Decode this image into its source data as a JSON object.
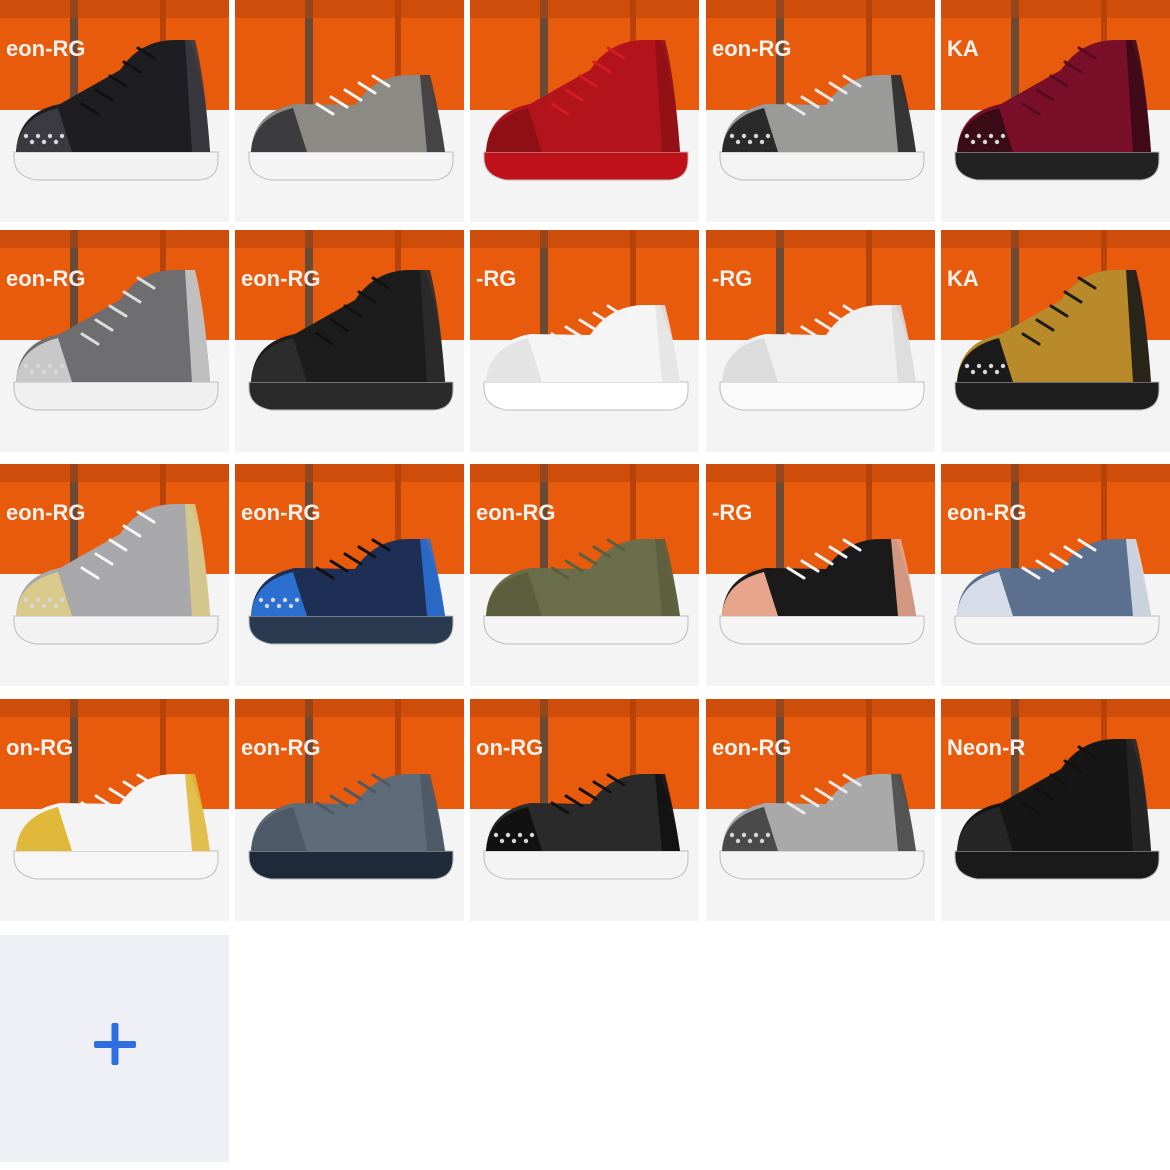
{
  "gallery": {
    "photos": [
      {
        "label": "eon-RG",
        "shoe": {
          "upper": "#1e1e22",
          "accent": "#3a3a40",
          "sole": "#f2f2f2",
          "laces": "#111111",
          "spikes": true,
          "high": true
        }
      },
      {
        "label": "",
        "shoe": {
          "upper": "#8c8a84",
          "accent": "#3c3c3e",
          "sole": "#f4f4f4",
          "laces": "#f4f4f4",
          "spikes": false,
          "high": false
        }
      },
      {
        "label": "",
        "shoe": {
          "upper": "#b3141c",
          "accent": "#8f0f16",
          "sole": "#c0121a",
          "laces": "#d21d25",
          "spikes": false,
          "high": true
        }
      },
      {
        "label": "eon-RG",
        "shoe": {
          "upper": "#9a9a98",
          "accent": "#2a2a2a",
          "sole": "#f3f3f3",
          "laces": "#e9e9e9",
          "spikes": true,
          "high": false
        }
      },
      {
        "label": "KA",
        "shoe": {
          "upper": "#7a0f2a",
          "accent": "#3a0a16",
          "sole": "#222222",
          "laces": "#5a0a1e",
          "spikes": true,
          "high": true
        }
      },
      {
        "label": "eon-RG",
        "shoe": {
          "upper": "#6e6e70",
          "accent": "#c8c8c8",
          "sole": "#f0f0f0",
          "laces": "#dddddd",
          "spikes": true,
          "high": true
        }
      },
      {
        "label": "eon-RG",
        "shoe": {
          "upper": "#1c1c1c",
          "accent": "#2c2c2c",
          "sole": "#2a2a2a",
          "laces": "#111111",
          "spikes": false,
          "high": true
        }
      },
      {
        "label": "-RG",
        "shoe": {
          "upper": "#f5f5f5",
          "accent": "#e4e4e4",
          "sole": "#ffffff",
          "laces": "#f0f0f0",
          "spikes": false,
          "high": false
        }
      },
      {
        "label": "-RG",
        "shoe": {
          "upper": "#efefef",
          "accent": "#dcdcdc",
          "sole": "#fafafa",
          "laces": "#eeeeee",
          "spikes": false,
          "high": false
        }
      },
      {
        "label": "KA",
        "shoe": {
          "upper": "#b88a2a",
          "accent": "#1a1a1a",
          "sole": "#1e1e1e",
          "laces": "#1a1a1a",
          "spikes": true,
          "high": true
        }
      },
      {
        "label": "eon-RG",
        "shoe": {
          "upper": "#a8a8aa",
          "accent": "#d9c98a",
          "sole": "#f2f2f2",
          "laces": "#f5f5f5",
          "spikes": true,
          "high": true
        }
      },
      {
        "label": "eon-RG",
        "shoe": {
          "upper": "#1e2f55",
          "accent": "#2b6fd1",
          "sole": "#2a3a50",
          "laces": "#111111",
          "spikes": true,
          "high": false
        }
      },
      {
        "label": "eon-RG",
        "shoe": {
          "upper": "#6b6e4a",
          "accent": "#5c5f3e",
          "sole": "#f4f4f4",
          "laces": "#5c5f3e",
          "spikes": false,
          "high": false
        }
      },
      {
        "label": "-RG",
        "shoe": {
          "upper": "#1a1a1a",
          "accent": "#e7a58c",
          "sole": "#f4f4f4",
          "laces": "#f5f5f5",
          "spikes": false,
          "high": false
        }
      },
      {
        "label": "eon-RG",
        "shoe": {
          "upper": "#5b6f8f",
          "accent": "#d7dde8",
          "sole": "#f4f4f4",
          "laces": "#f5f5f5",
          "spikes": false,
          "high": false
        }
      },
      {
        "label": "on-RG",
        "shoe": {
          "upper": "#f4f4f4",
          "accent": "#e0b93a",
          "sole": "#f6f6f6",
          "laces": "#f5f5f5",
          "spikes": false,
          "high": false
        }
      },
      {
        "label": "eon-RG",
        "shoe": {
          "upper": "#5e6b78",
          "accent": "#4d5966",
          "sole": "#1e2a3a",
          "laces": "#4d5966",
          "spikes": false,
          "high": false
        }
      },
      {
        "label": "on-RG",
        "shoe": {
          "upper": "#2a2a2a",
          "accent": "#111111",
          "sole": "#f4f4f4",
          "laces": "#111111",
          "spikes": true,
          "high": false
        }
      },
      {
        "label": "eon-RG",
        "shoe": {
          "upper": "#a9a9a9",
          "accent": "#4a4a4a",
          "sole": "#f4f4f4",
          "laces": "#e9e9e9",
          "spikes": true,
          "high": false
        }
      },
      {
        "label": "Neon-R",
        "shoe": {
          "upper": "#161616",
          "accent": "#262626",
          "sole": "#1a1a1a",
          "laces": "#111111",
          "spikes": false,
          "high": true
        }
      }
    ],
    "add_button": {
      "icon": "plus-icon",
      "color": "#2d6fe0"
    }
  },
  "colors": {
    "backdrop": "#e85a0c",
    "backdrop_dark": "#b8430a",
    "wood": "#6b4a35",
    "floor": "#f4f4f4",
    "tile_gap": "#ffffff"
  }
}
